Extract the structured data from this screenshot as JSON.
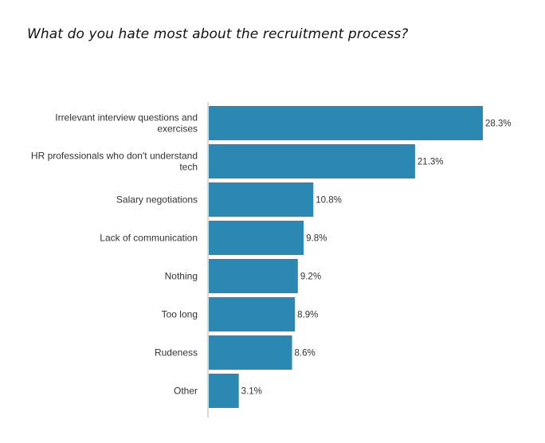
{
  "chart_data": {
    "type": "bar",
    "orientation": "horizontal",
    "title": "What do you hate most about the recruitment process?",
    "xlabel": "",
    "ylabel": "",
    "categories": [
      [
        "Irrelevant interview questions and",
        "exercises"
      ],
      [
        "HR professionals who don't understand",
        "tech"
      ],
      [
        "Salary negotiations"
      ],
      [
        "Lack of communication"
      ],
      [
        "Nothing"
      ],
      [
        "Too long"
      ],
      [
        "Rudeness"
      ],
      [
        "Other"
      ]
    ],
    "values": [
      28.3,
      21.3,
      10.8,
      9.8,
      9.2,
      8.9,
      8.6,
      3.1
    ],
    "value_labels": [
      "28.3%",
      "21.3%",
      "10.8%",
      "9.8%",
      "9.2%",
      "8.9%",
      "8.6%",
      "3.1%"
    ],
    "unit": "%",
    "xlim": [
      0,
      28.3
    ],
    "grid": false,
    "legend": "none",
    "bar_color": "#2a88b2",
    "axis_color": "#d9d9d9"
  }
}
